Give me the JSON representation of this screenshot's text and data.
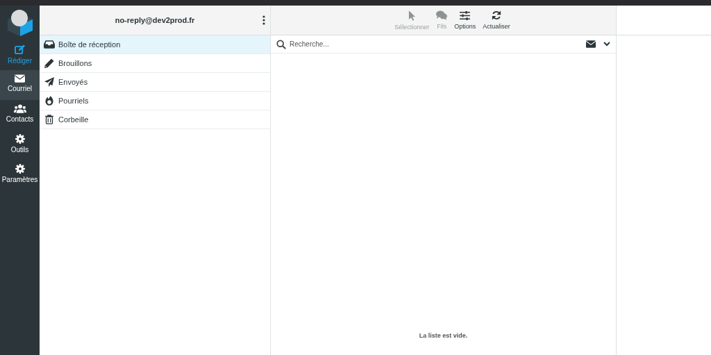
{
  "nav": [
    {
      "label": "Rédiger",
      "kind": "compose",
      "selected": false
    },
    {
      "label": "Courriel",
      "kind": "item",
      "selected": true
    },
    {
      "label": "Contacts",
      "kind": "item",
      "selected": false
    },
    {
      "label": "Outils",
      "kind": "item",
      "selected": false
    },
    {
      "label": "Paramètres",
      "kind": "item",
      "selected": false
    }
  ],
  "account": {
    "title": "no-reply@dev2prod.fr"
  },
  "folders": [
    {
      "label": "Boîte de réception",
      "selected": true
    },
    {
      "label": "Brouillons",
      "selected": false
    },
    {
      "label": "Envoyés",
      "selected": false
    },
    {
      "label": "Pourriels",
      "selected": false
    },
    {
      "label": "Corbeille",
      "selected": false
    }
  ],
  "toolbar": [
    {
      "label": "Sélectionner",
      "disabled": true
    },
    {
      "label": "Fils",
      "disabled": true
    },
    {
      "label": "Options",
      "disabled": false
    },
    {
      "label": "Actualiser",
      "disabled": false
    }
  ],
  "search": {
    "placeholder": "Recherche..."
  },
  "message_list": {
    "empty_text": "La liste est vide."
  }
}
